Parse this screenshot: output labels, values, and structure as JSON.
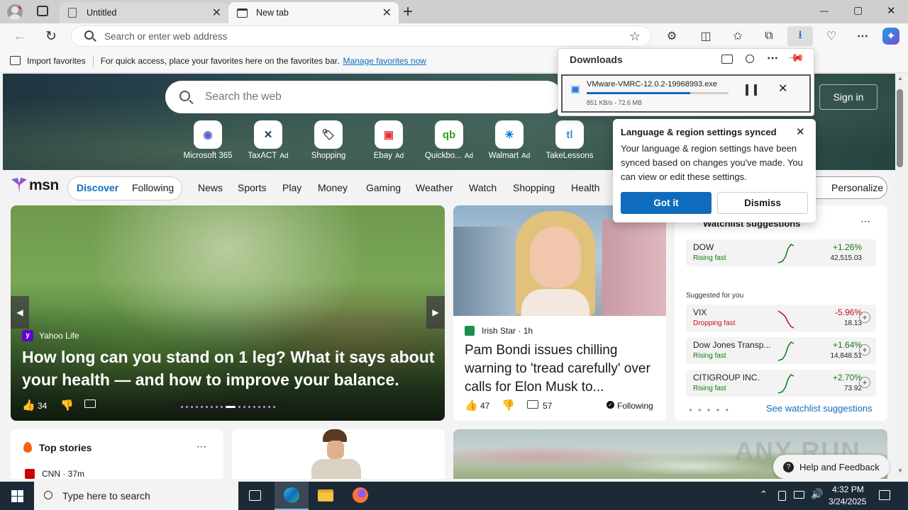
{
  "tabs": [
    {
      "label": "Untitled"
    },
    {
      "label": "New tab"
    }
  ],
  "window_controls": {
    "minimize": "—",
    "maximize": "▢",
    "close": "✕"
  },
  "address_bar": {
    "placeholder": "Search or enter web address"
  },
  "favorites_bar": {
    "import_label": "Import favorites",
    "hint": "For quick access, place your favorites here on the favorites bar.",
    "manage_link": "Manage favorites now"
  },
  "downloads": {
    "title": "Downloads",
    "file_name": "VMware-VMRC-12.0.2-19968993.exe",
    "status": "851 KB/s - 72.6 MB",
    "progress": 0.73
  },
  "sync_popup": {
    "title": "Language & region settings synced",
    "body": "Your language & region settings have been synced based on changes you've made. You can view or edit these settings.",
    "got_it": "Got it",
    "dismiss": "Dismiss"
  },
  "web_search": {
    "placeholder": "Search the web"
  },
  "sign_in": "Sign in",
  "quick_links": [
    {
      "label": "Microsoft 365",
      "ad": "",
      "glyph": "◉",
      "color": "#5b5fc7"
    },
    {
      "label": "TaxACT",
      "ad": "Ad",
      "glyph": "✕",
      "color": "#1d3a5c"
    },
    {
      "label": "Shopping",
      "ad": "",
      "glyph": "🏷",
      "color": "#333333"
    },
    {
      "label": "Ebay",
      "ad": "Ad",
      "glyph": "▣",
      "color": "#e53238"
    },
    {
      "label": "Quickbo...",
      "ad": "Ad",
      "glyph": "qb",
      "color": "#2ca01c"
    },
    {
      "label": "Walmart",
      "ad": "Ad",
      "glyph": "✳",
      "color": "#0071ce"
    },
    {
      "label": "TakeLessons",
      "ad": "",
      "glyph": "tl",
      "color": "#3a8ed8"
    }
  ],
  "msn": {
    "logo": "msn",
    "discover": "Discover",
    "following": "Following",
    "nav": [
      "News",
      "Sports",
      "Play",
      "Money",
      "Gaming",
      "Weather",
      "Watch",
      "Shopping",
      "Health"
    ],
    "personalize": "Personalize"
  },
  "hero_story": {
    "source": "Yahoo Life",
    "headline": "How long can you stand on 1 leg? What it says about your health — and how to improve your balance.",
    "likes": "34"
  },
  "side_story": {
    "source": "Irish Star",
    "age": "1h",
    "headline": "Pam Bondi issues chilling warning to 'tread carefully' over calls for Elon Musk to...",
    "likes": "47",
    "comments": "57",
    "following": "Following"
  },
  "watchlist": {
    "title": "Watchlist suggestions",
    "suggested": "Suggested for you",
    "see_all": "See watchlist suggestions",
    "items": [
      {
        "name": "DOW",
        "tag": "Rising fast",
        "change": "+1.26%",
        "value": "42,515.03",
        "up": true
      },
      {
        "name": "VIX",
        "tag": "Dropping fast",
        "change": "-5.96%",
        "value": "18.13",
        "up": false
      },
      {
        "name": "Dow Jones Transp...",
        "tag": "Rising fast",
        "change": "+1.64%",
        "value": "14,848.51",
        "up": true
      },
      {
        "name": "CITIGROUP INC.",
        "tag": "Rising fast",
        "change": "+2.70%",
        "value": "73.92",
        "up": true
      }
    ]
  },
  "top_stories": {
    "title": "Top stories",
    "first_source": "CNN",
    "first_age": "37m"
  },
  "help_feedback": "Help and Feedback",
  "watermark": "ANY RUN",
  "taskbar": {
    "search_placeholder": "Type here to search",
    "time": "4:32 PM",
    "date": "3/24/2025"
  },
  "colors": {
    "accent": "#0f6cbd",
    "up": "#107c10",
    "down": "#c50f1f"
  }
}
